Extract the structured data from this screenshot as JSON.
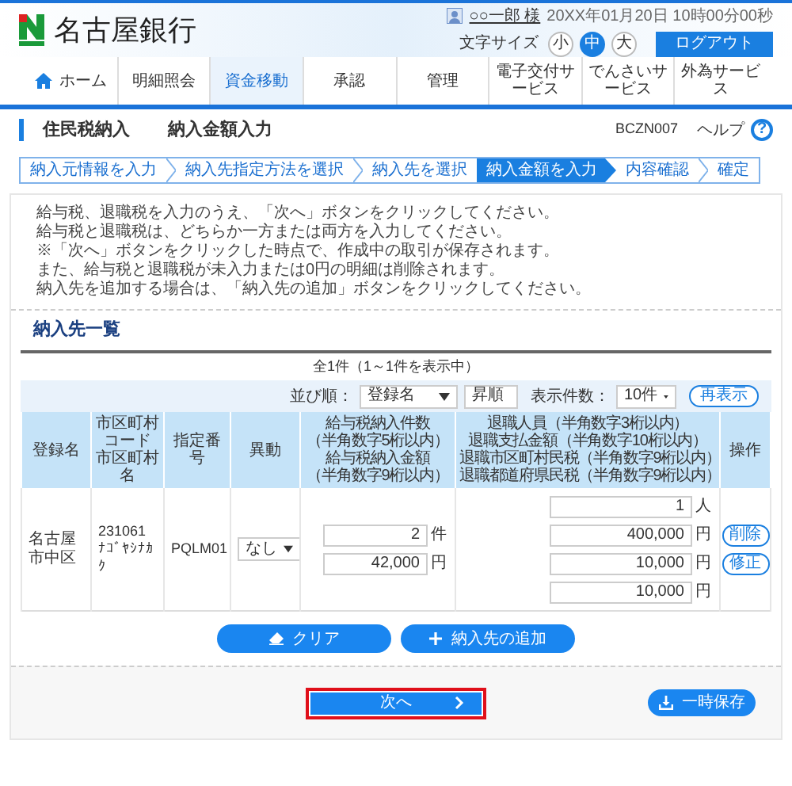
{
  "header": {
    "bank_name": "名古屋銀行",
    "user": "○○一郎 様",
    "datetime": "20XX年01月20日 10時00分00秒",
    "font_size_label": "文字サイズ",
    "font_sizes": [
      {
        "label": "小",
        "selected": false
      },
      {
        "label": "中",
        "selected": true
      },
      {
        "label": "大",
        "selected": false
      }
    ],
    "logout": "ログアウト"
  },
  "nav": [
    {
      "label": "ホーム",
      "kind": "home",
      "selected": false
    },
    {
      "label": "明細照会",
      "kind": "text",
      "selected": false
    },
    {
      "label": "資金移動",
      "kind": "text",
      "selected": true
    },
    {
      "label": "承認",
      "kind": "text",
      "selected": false
    },
    {
      "label": "管理",
      "kind": "text",
      "selected": false
    },
    {
      "label": "電子交付サービス",
      "kind": "text",
      "selected": false
    },
    {
      "label": "でんさいサービス",
      "kind": "text",
      "selected": false
    },
    {
      "label": "外為サービス",
      "kind": "text",
      "selected": false
    }
  ],
  "page": {
    "title": "住民税納入",
    "subtitle": "納入金額入力",
    "screen_id": "BCZN007",
    "help": "ヘルプ",
    "help_mark": "?"
  },
  "steps": [
    {
      "label": "納入元情報を入力",
      "selected": false
    },
    {
      "label": "納入先指定方法を選択",
      "selected": false
    },
    {
      "label": "納入先を選択",
      "selected": false
    },
    {
      "label": "納入金額を入力",
      "selected": true
    },
    {
      "label": "内容確認",
      "selected": false
    },
    {
      "label": "確定",
      "selected": false
    }
  ],
  "instructions": [
    "給与税、退職税を入力のうえ、「次へ」ボタンをクリックしてください。",
    "給与税と退職税は、どちらか一方または両方を入力してください。",
    "※「次へ」ボタンをクリックした時点で、作成中の取引が保存されます。",
    "また、給与税と退職税が未入力または0円の明細は削除されます。",
    "納入先を追加する場合は、「納入先の追加」ボタンをクリックしてください。"
  ],
  "section_title": "納入先一覧",
  "count": "全1件（1～1件を表示中）",
  "sort": {
    "label": "並び順：",
    "field": "登録名",
    "order": "昇順",
    "per_page_label": "表示件数：",
    "per_page": "10件",
    "refresh": "再表示"
  },
  "table": {
    "columns": [
      [
        "登録名"
      ],
      [
        "市区町村コード",
        "市区町村名"
      ],
      [
        "指定番号"
      ],
      [
        "異動"
      ],
      [
        "給与税納入件数",
        "（半角数字5桁以内）",
        "給与税納入金額",
        "（半角数字9桁以内）"
      ],
      [
        "退職人員（半角数字3桁以内）",
        "退職支払金額（半角数字10桁以内）",
        "退職市区町村民税（半角数字9桁以内）",
        "退職都道府県民税（半角数字9桁以内）"
      ],
      [
        "操作"
      ]
    ],
    "rows": [
      {
        "name": "名古屋市中区",
        "code": "231061",
        "city": "ﾅｺﾞﾔｼﾅｶｸ",
        "number": "PQLM01",
        "change": "なし",
        "salary": [
          {
            "value": "2",
            "unit": "件"
          },
          {
            "value": "42,000",
            "unit": "円"
          }
        ],
        "retire": [
          {
            "value": "1",
            "unit": "人"
          },
          {
            "value": "400,000",
            "unit": "円"
          },
          {
            "value": "10,000",
            "unit": "円"
          },
          {
            "value": "10,000",
            "unit": "円"
          }
        ],
        "actions": [
          "削除",
          "修正"
        ]
      }
    ]
  },
  "buttons": {
    "clear": "クリア",
    "add": "納入先の追加"
  },
  "footer": {
    "next": {
      "label": "次へ",
      "highlighted": true
    },
    "save": "一時保存"
  }
}
